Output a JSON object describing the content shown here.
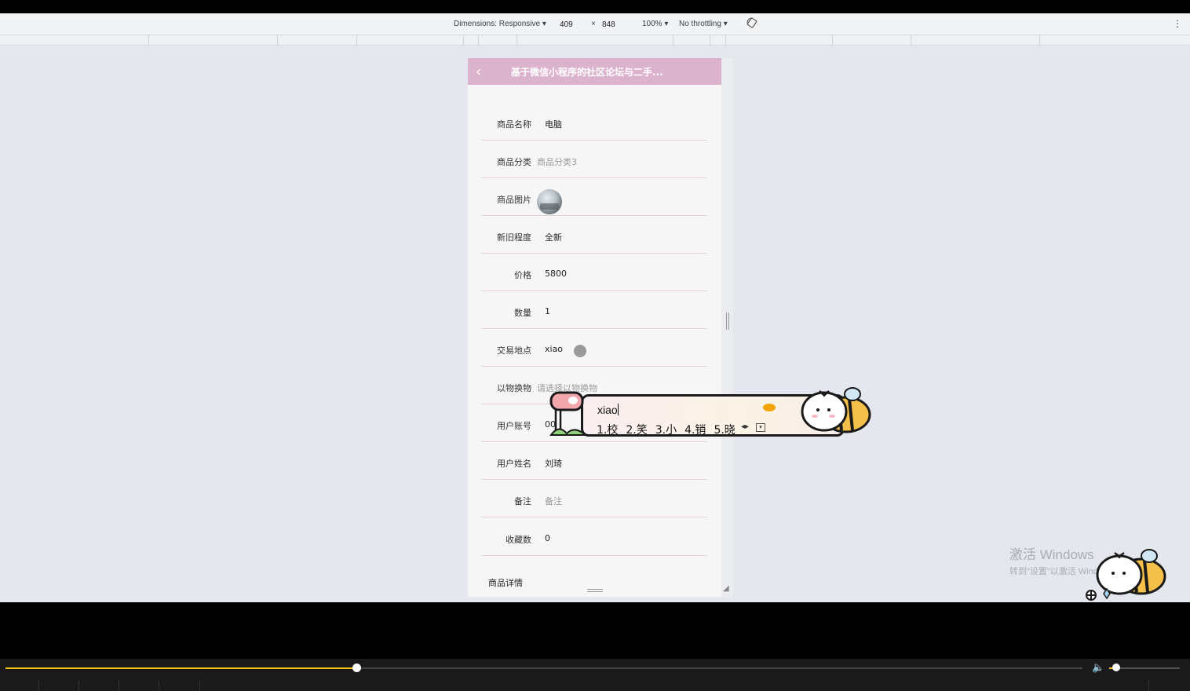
{
  "devtools": {
    "dimensions_label": "Dimensions: Responsive ▾",
    "width": "409",
    "times": "×",
    "height": "848",
    "zoom": "100% ▾",
    "throttling": "No throttling ▾",
    "rotate_icon": "rotate-icon",
    "more_icon": "⋮"
  },
  "app": {
    "back_icon": "‹",
    "title": "基于微信小程序的社区论坛与二手..."
  },
  "form": {
    "rows": [
      {
        "label": "商品名称",
        "value": "电脑"
      },
      {
        "label": "商品分类",
        "value": "商品分类3"
      },
      {
        "label": "商品图片",
        "value": ""
      },
      {
        "label": "新旧程度",
        "value": "全新"
      },
      {
        "label": "价格",
        "value": "5800"
      },
      {
        "label": "数量",
        "value": "1"
      },
      {
        "label": "交易地点",
        "value": "xiao"
      },
      {
        "label": "以物换物",
        "value": "请选择以物换物"
      },
      {
        "label": "用户账号",
        "value": "00"
      },
      {
        "label": "用户姓名",
        "value": "刘琦"
      },
      {
        "label": "备注",
        "value": "备注"
      },
      {
        "label": "收藏数",
        "value": "0"
      }
    ],
    "section_title": "商品详情"
  },
  "ime": {
    "input": "xiao",
    "candidates": [
      "1.校",
      "2.笑",
      "3.小",
      "4.销",
      "5.晓"
    ],
    "arrows": "◂▸",
    "dropdown": "▾"
  },
  "watermark": {
    "line1": "激活 Windows",
    "line2": "转到\"设置\"以激活 Windows。"
  },
  "player": {
    "progress_fraction": 0.326,
    "volume_fraction": 0.1,
    "volume_icon": "🔈"
  },
  "colors": {
    "nav_bg": "#dcb3cc",
    "progress": "#f0c419"
  }
}
